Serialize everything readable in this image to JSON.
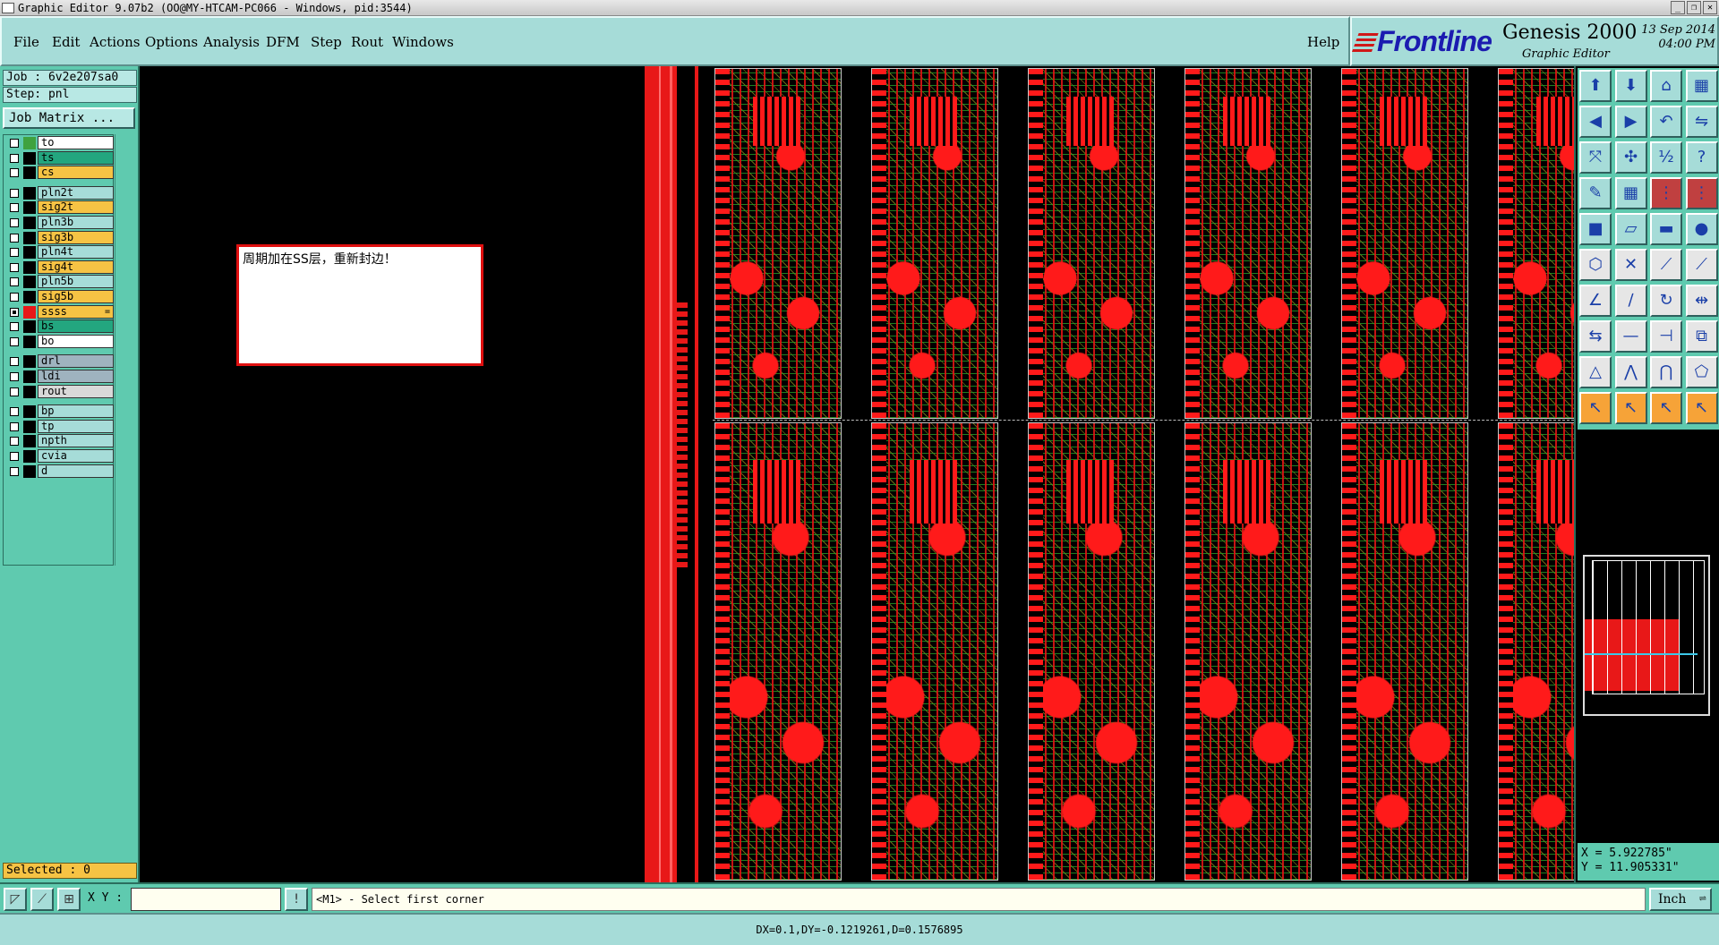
{
  "window": {
    "title": "Graphic Editor 9.07b2 (OO@MY-HTCAM-PC066 - Windows, pid:3544)"
  },
  "menu": {
    "items": [
      "File",
      "Edit",
      "Actions",
      "Options",
      "Analysis",
      "DFM",
      "Step",
      "Rout",
      "Windows"
    ],
    "help": "Help"
  },
  "brand": {
    "logo": "Frontline",
    "product": "Genesis 2000",
    "subtitle": "Graphic Editor",
    "date": "13 Sep 2014",
    "time": "04:00 PM"
  },
  "job": {
    "job_label": "Job : 6v2e207sa0",
    "step_label": "Step: pnl",
    "matrix_button": "Job Matrix ..."
  },
  "layers": [
    {
      "name": "to",
      "color": "#ffffff",
      "swatch": "#3fa23f",
      "checked": false
    },
    {
      "name": "ts",
      "color": "#23a67f",
      "swatch": "#000000",
      "checked": false
    },
    {
      "name": "cs",
      "color": "#f6c344",
      "swatch": "#000000",
      "checked": false
    },
    {
      "name": "pln2t",
      "color": "#a6dcd8",
      "swatch": "#000000",
      "checked": false
    },
    {
      "name": "sig2t",
      "color": "#f6c344",
      "swatch": "#000000",
      "checked": false
    },
    {
      "name": "pln3b",
      "color": "#a6dcd8",
      "swatch": "#000000",
      "checked": false
    },
    {
      "name": "sig3b",
      "color": "#f6c344",
      "swatch": "#000000",
      "checked": false
    },
    {
      "name": "pln4t",
      "color": "#a6dcd8",
      "swatch": "#000000",
      "checked": false
    },
    {
      "name": "sig4t",
      "color": "#f6c344",
      "swatch": "#000000",
      "checked": false
    },
    {
      "name": "pln5b",
      "color": "#a6dcd8",
      "swatch": "#000000",
      "checked": false
    },
    {
      "name": "sig5b",
      "color": "#f6c344",
      "swatch": "#000000",
      "checked": false
    },
    {
      "name": "ss",
      "color": "#f6c344",
      "swatch": "#e81818",
      "checked": true,
      "mark": "="
    },
    {
      "name": "bs",
      "color": "#23a67f",
      "swatch": "#000000",
      "checked": false
    },
    {
      "name": "bo",
      "color": "#ffffff",
      "swatch": "#000000",
      "checked": false
    },
    {
      "name": "drl",
      "color": "#9fb3bf",
      "swatch": "#000000",
      "checked": false
    },
    {
      "name": "ldi",
      "color": "#9fb3bf",
      "swatch": "#000000",
      "checked": false
    },
    {
      "name": "rout",
      "color": "#d9d9d9",
      "swatch": "#000000",
      "checked": false
    },
    {
      "name": "bp",
      "color": "#a6dcd8",
      "swatch": "#000000",
      "checked": false
    },
    {
      "name": "tp",
      "color": "#a6dcd8",
      "swatch": "#000000",
      "checked": false
    },
    {
      "name": "npth",
      "color": "#a6dcd8",
      "swatch": "#000000",
      "checked": false
    },
    {
      "name": "cvia",
      "color": "#a6dcd8",
      "swatch": "#000000",
      "checked": false
    },
    {
      "name": "d",
      "color": "#a6dcd8",
      "swatch": "#000000",
      "checked": false
    }
  ],
  "selection": {
    "label": "Selected : 0"
  },
  "note": {
    "text": "周期加在SS层，重新封边！"
  },
  "coords": {
    "x": "X = 5.922785\"",
    "y": "Y = 11.905331\""
  },
  "command": {
    "xy_label": "X Y :",
    "xy_value": "",
    "prompt": "<M1> - Select first corner",
    "units": "Inch"
  },
  "status": {
    "text": "DX=0.1,DY=-0.1219261,D=0.1576895"
  },
  "toolbar": {
    "icons": [
      "open-icon",
      "save-icon",
      "home-icon",
      "layout-icon",
      "pan-left-icon",
      "pan-right-icon",
      "undo-step-icon",
      "flip-icon",
      "zoom-fit-icon",
      "zoom-center-icon",
      "scale-icon",
      "help-icon",
      "measure-icon",
      "grid-icon",
      "snap-icon",
      "snap-net-icon",
      "pad-icon",
      "line-draw-icon",
      "ruler-icon",
      "circle-icon",
      "net-icon",
      "cross-icon",
      "connect-icon",
      "route-icon",
      "slope-icon",
      "slash-icon",
      "rotate-icon",
      "mirror-icon",
      "move-icon",
      "minus-icon",
      "trim-icon",
      "copy-icon",
      "triangle-icon",
      "arc-icon",
      "angle-icon",
      "polygon-icon",
      "pointer-icon",
      "pointer-select-icon",
      "pointer-alt-icon",
      "pointer-net-icon"
    ]
  }
}
